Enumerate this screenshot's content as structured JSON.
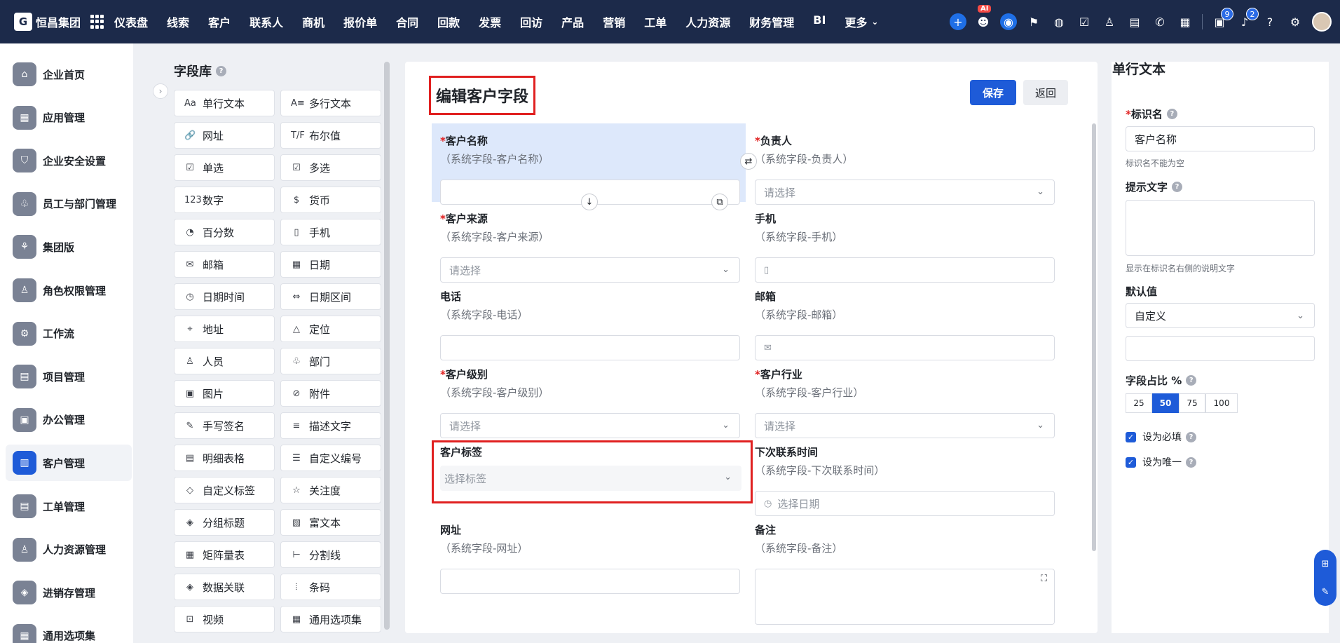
{
  "app": {
    "company": "恒昌集团",
    "logo_letter": "G"
  },
  "nav": [
    "仪表盘",
    "线索",
    "客户",
    "联系人",
    "商机",
    "报价单",
    "合同",
    "回款",
    "发票",
    "回访",
    "产品",
    "营销",
    "工单",
    "人力资源",
    "财务管理",
    "BI"
  ],
  "nav_more": "更多",
  "toolbar": {
    "ai_badge": "AI",
    "task_badge": "9",
    "bell_badge": "2"
  },
  "sidebar": [
    "企业首页",
    "应用管理",
    "企业安全设置",
    "员工与部门管理",
    "集团版",
    "角色权限管理",
    "工作流",
    "项目管理",
    "办公管理",
    "客户管理",
    "工单管理",
    "人力资源管理",
    "进销存管理",
    "通用选项集"
  ],
  "sidebar_active": "客户管理",
  "library": {
    "title": "字段库",
    "items": [
      {
        "label": "单行文本",
        "icon": "Aa"
      },
      {
        "label": "多行文本",
        "icon": "A≡"
      },
      {
        "label": "网址",
        "icon": "🔗"
      },
      {
        "label": "布尔值",
        "icon": "T/F"
      },
      {
        "label": "单选",
        "icon": "☑"
      },
      {
        "label": "多选",
        "icon": "☑"
      },
      {
        "label": "数字",
        "icon": "123"
      },
      {
        "label": "货币",
        "icon": "$"
      },
      {
        "label": "百分数",
        "icon": "◔"
      },
      {
        "label": "手机",
        "icon": "▯"
      },
      {
        "label": "邮箱",
        "icon": "✉"
      },
      {
        "label": "日期",
        "icon": "▦"
      },
      {
        "label": "日期时间",
        "icon": "◷"
      },
      {
        "label": "日期区间",
        "icon": "⇔"
      },
      {
        "label": "地址",
        "icon": "⌖"
      },
      {
        "label": "定位",
        "icon": "△"
      },
      {
        "label": "人员",
        "icon": "♙"
      },
      {
        "label": "部门",
        "icon": "♧"
      },
      {
        "label": "图片",
        "icon": "▣"
      },
      {
        "label": "附件",
        "icon": "⊘"
      },
      {
        "label": "手写签名",
        "icon": "✎"
      },
      {
        "label": "描述文字",
        "icon": "≡"
      },
      {
        "label": "明细表格",
        "icon": "▤"
      },
      {
        "label": "自定义编号",
        "icon": "☰"
      },
      {
        "label": "自定义标签",
        "icon": "◇"
      },
      {
        "label": "关注度",
        "icon": "☆"
      },
      {
        "label": "分组标题",
        "icon": "◈"
      },
      {
        "label": "富文本",
        "icon": "▧"
      },
      {
        "label": "矩阵量表",
        "icon": "▦"
      },
      {
        "label": "分割线",
        "icon": "⊢"
      },
      {
        "label": "数据关联",
        "icon": "◈"
      },
      {
        "label": "条码",
        "icon": "⦙"
      },
      {
        "label": "视频",
        "icon": "⊡"
      },
      {
        "label": "通用选项集",
        "icon": "▦"
      }
    ]
  },
  "form": {
    "title": "编辑客户字段",
    "save": "保存",
    "back": "返回",
    "fields": [
      {
        "label": "客户名称",
        "required": true,
        "sub": "（系统字段-客户名称）",
        "placeholder": "",
        "type": "text"
      },
      {
        "label": "负责人",
        "required": true,
        "sub": "（系统字段-负责人）",
        "placeholder": "请选择",
        "type": "select"
      },
      {
        "label": "客户来源",
        "required": true,
        "sub": "（系统字段-客户来源）",
        "placeholder": "请选择",
        "type": "select"
      },
      {
        "label": "手机",
        "required": false,
        "sub": "（系统字段-手机）",
        "placeholder": "",
        "type": "phone"
      },
      {
        "label": "电话",
        "required": false,
        "sub": "（系统字段-电话）",
        "placeholder": "",
        "type": "text"
      },
      {
        "label": "邮箱",
        "required": false,
        "sub": "（系统字段-邮箱）",
        "placeholder": "",
        "type": "email"
      },
      {
        "label": "客户级别",
        "required": true,
        "sub": "（系统字段-客户级别）",
        "placeholder": "请选择",
        "type": "select"
      },
      {
        "label": "客户行业",
        "required": true,
        "sub": "（系统字段-客户行业）",
        "placeholder": "请选择",
        "type": "select"
      },
      {
        "label": "客户标签",
        "required": false,
        "sub": "",
        "placeholder": "选择标签",
        "type": "tag"
      },
      {
        "label": "下次联系时间",
        "required": false,
        "sub": "（系统字段-下次联系时间）",
        "placeholder": "选择日期",
        "type": "date"
      },
      {
        "label": "网址",
        "required": false,
        "sub": "（系统字段-网址）",
        "placeholder": "",
        "type": "text"
      },
      {
        "label": "备注",
        "required": false,
        "sub": "（系统字段-备注）",
        "placeholder": "",
        "type": "textarea"
      }
    ]
  },
  "props": {
    "title": "单行文本",
    "name_label": "标识名",
    "name_value": "客户名称",
    "name_hint": "标识名不能为空",
    "tip_label": "提示文字",
    "tip_hint": "显示在标识名右侧的说明文字",
    "default_label": "默认值",
    "default_value": "自定义",
    "ratio_label": "字段占比 %",
    "ratio_options": [
      "25",
      "50",
      "75",
      "100"
    ],
    "ratio_selected": "50",
    "required_label": "设为必填",
    "unique_label": "设为唯一"
  }
}
